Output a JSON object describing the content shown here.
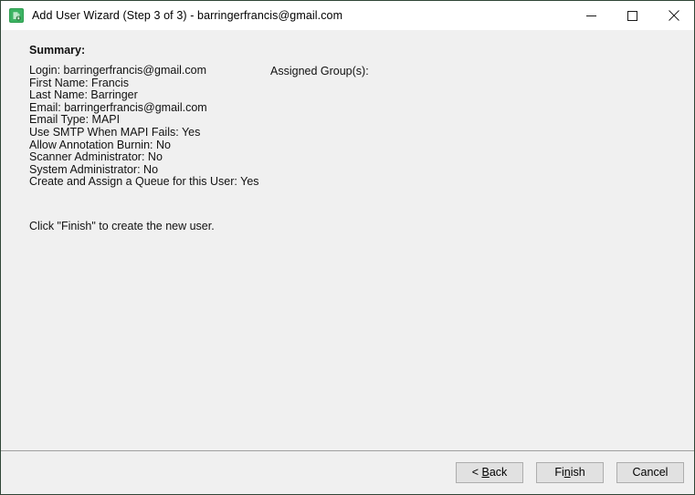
{
  "window": {
    "title": "Add User Wizard (Step 3 of 3) - barringerfrancis@gmail.com",
    "icon": "app-lock-icon",
    "border_color": "#2f4536",
    "titlebar_bg": "#ffffff",
    "body_bg": "#f0f0f0",
    "controls": {
      "minimize": "minimize-icon",
      "maximize": "maximize-icon",
      "close": "close-icon"
    }
  },
  "main": {
    "summary_heading": "Summary:",
    "summary_lines": [
      "Login: barringerfrancis@gmail.com",
      "First Name: Francis",
      "Last Name: Barringer",
      "Email: barringerfrancis@gmail.com",
      "Email Type: MAPI",
      "Use SMTP When MAPI Fails: Yes",
      "Allow Annotation Burnin: No",
      "Scanner Administrator: No",
      "System Administrator: No",
      "Create and Assign a Queue for this User: Yes"
    ],
    "assigned_groups_label": "Assigned Group(s):",
    "assigned_groups": [],
    "finish_hint": "Click \"Finish\" to create the new user."
  },
  "footer": {
    "back_label_prefix": "< ",
    "back_label_mnemonic": "B",
    "back_label_suffix": "ack",
    "finish_label_prefix": "Fi",
    "finish_label_mnemonic": "n",
    "finish_label_suffix": "ish",
    "cancel_label": "Cancel"
  }
}
